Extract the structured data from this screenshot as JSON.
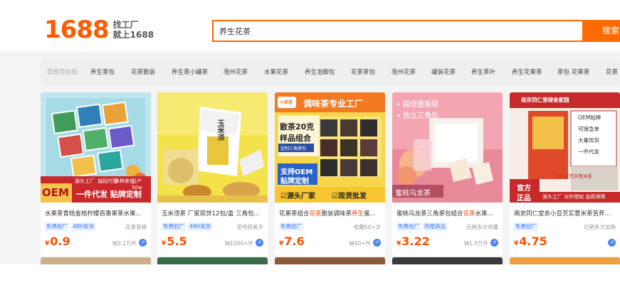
{
  "header": {
    "logo_number": "1688",
    "logo_line1": "找工厂",
    "logo_line2": "就上1688",
    "search_value": "养生花茶",
    "search_button": "搜索"
  },
  "suggest": {
    "label": "您是否在找:",
    "items": [
      "养生茶包",
      "花茶散装",
      "养生茶小罐茶",
      "亳州花茶",
      "水果花茶",
      "养生泡脚包",
      "花茶茶包",
      "亳州花茶",
      "罐装花茶",
      "养生茶叶",
      "养生花果茶",
      "茶包 花果茶",
      "花茶"
    ]
  },
  "cards": [
    {
      "title": "水果茶青桔金桔柠檬百香果茶水果...",
      "tags": [
        "免费验厂",
        "48H发货"
      ],
      "note": "花果茶榜",
      "price": "0.9",
      "sold": "销3.1万件",
      "image_texts": [
        "OEM",
        "一件代发 贴牌定制",
        "源头工厂",
        "诚招代理",
        "多种茶包",
        "日产50w"
      ]
    },
    {
      "title": "玉米须茶 厂家现货12包/盒 三角包...",
      "tags": [
        "免费验厂",
        "48H发货"
      ],
      "note": "茶传统美手",
      "price": "5.5",
      "sold": "销1000+件",
      "image_texts": [
        "玉米须"
      ]
    },
    {
      "title_pre": "花果茶组合",
      "title_hl1": "花茶",
      "title_mid": "散装调味茶",
      "title_hl2": "养生",
      "title_post": "蜜...",
      "tags": [
        "免费验厂"
      ],
      "note": "收藏60+次",
      "price": "7.6",
      "sold": "销40+件",
      "image_texts": [
        "小茶茶",
        "调味茶专业工厂",
        "散茶20克",
        "样品组合",
        "定制三角茶包",
        "支持OEM",
        "贴牌定制",
        "☑源头厂家",
        "☑现货批发"
      ]
    },
    {
      "title_pre": "蜜桃乌龙茶三角茶包组合",
      "title_hl1": "花茶",
      "title_post": "水果...",
      "tags": [
        "免费验厂",
        "热搜商品"
      ],
      "note": "近期多次收藏",
      "price": "3.22",
      "sold": "销1.5万件",
      "image_texts": [
        "• 超值量贩版",
        "• 独立三角包",
        "蜜桃乌龙茶"
      ]
    },
    {
      "title": "南京同仁堂赤小豆芡实薏米茶苦荞...",
      "tags": [
        "免费验厂"
      ],
      "note": "近期多次加购",
      "price": "4.75",
      "sold": "",
      "image_texts": [
        "南京同仁堂绿金家园",
        "OEM贴牌",
        "可接急单",
        "大量现货",
        "一件代发",
        "官方",
        "正品",
        "源头工厂 对外授权 品质保障",
        "赤小豆芡实薏米茶"
      ]
    }
  ],
  "currency": "¥",
  "colors": {
    "accent": "#ff6a00",
    "price": "#ff5000",
    "tag": "#3a78ff"
  }
}
